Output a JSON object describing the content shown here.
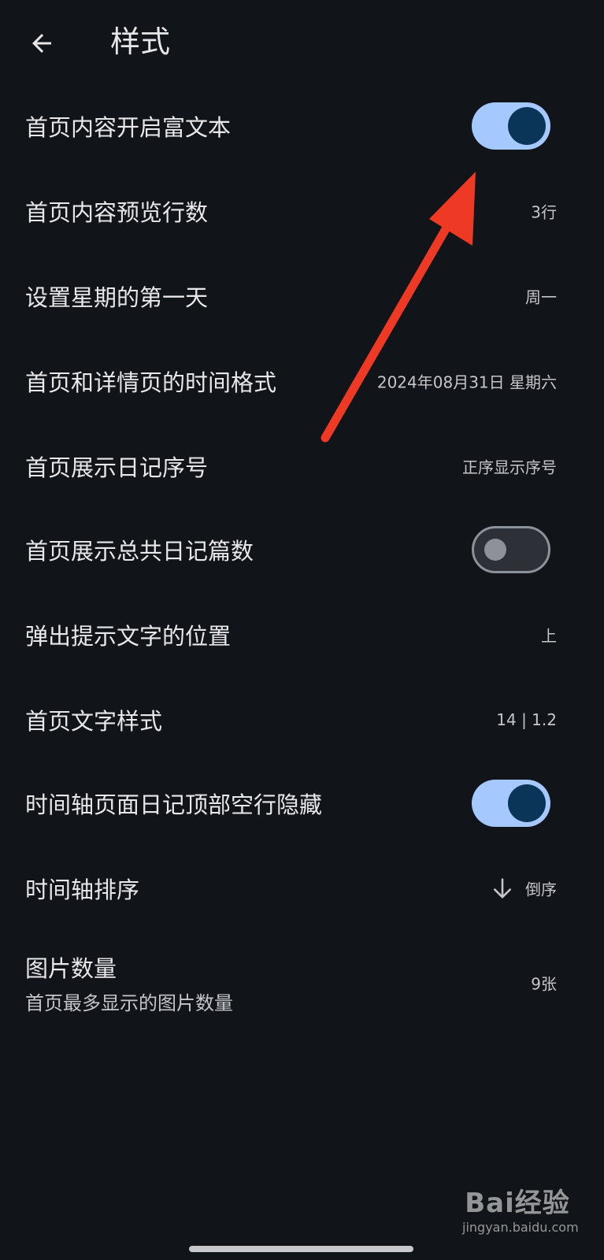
{
  "header": {
    "title": "样式"
  },
  "settings": [
    {
      "label": "首页内容开启富文本",
      "toggle": true
    },
    {
      "label": "首页内容预览行数",
      "value": "3行"
    },
    {
      "label": "设置星期的第一天",
      "value": "周一"
    },
    {
      "label": "首页和详情页的时间格式",
      "value": "2024年08月31日 星期六"
    },
    {
      "label": "首页展示日记序号",
      "value": "正序显示序号"
    },
    {
      "label": "首页展示总共日记篇数",
      "toggle": false
    },
    {
      "label": "弹出提示文字的位置",
      "value": "上"
    },
    {
      "label": "首页文字样式",
      "value": "14 | 1.2"
    },
    {
      "label": "时间轴页面日记顶部空行隐藏",
      "toggle": true
    },
    {
      "label": "时间轴排序",
      "value": "倒序",
      "icon": "arrow-down-icon"
    },
    {
      "label": "图片数量",
      "subtitle": "首页最多显示的图片数量",
      "value": "9张"
    }
  ],
  "colors": {
    "background": "#111418",
    "toggle_on_track": "#a5c8ff",
    "toggle_on_knob": "#0b3558",
    "annotation_arrow": "#ee3a24"
  },
  "watermark": {
    "brand": "Bai经验",
    "url": "jingyan.baidu.com"
  }
}
